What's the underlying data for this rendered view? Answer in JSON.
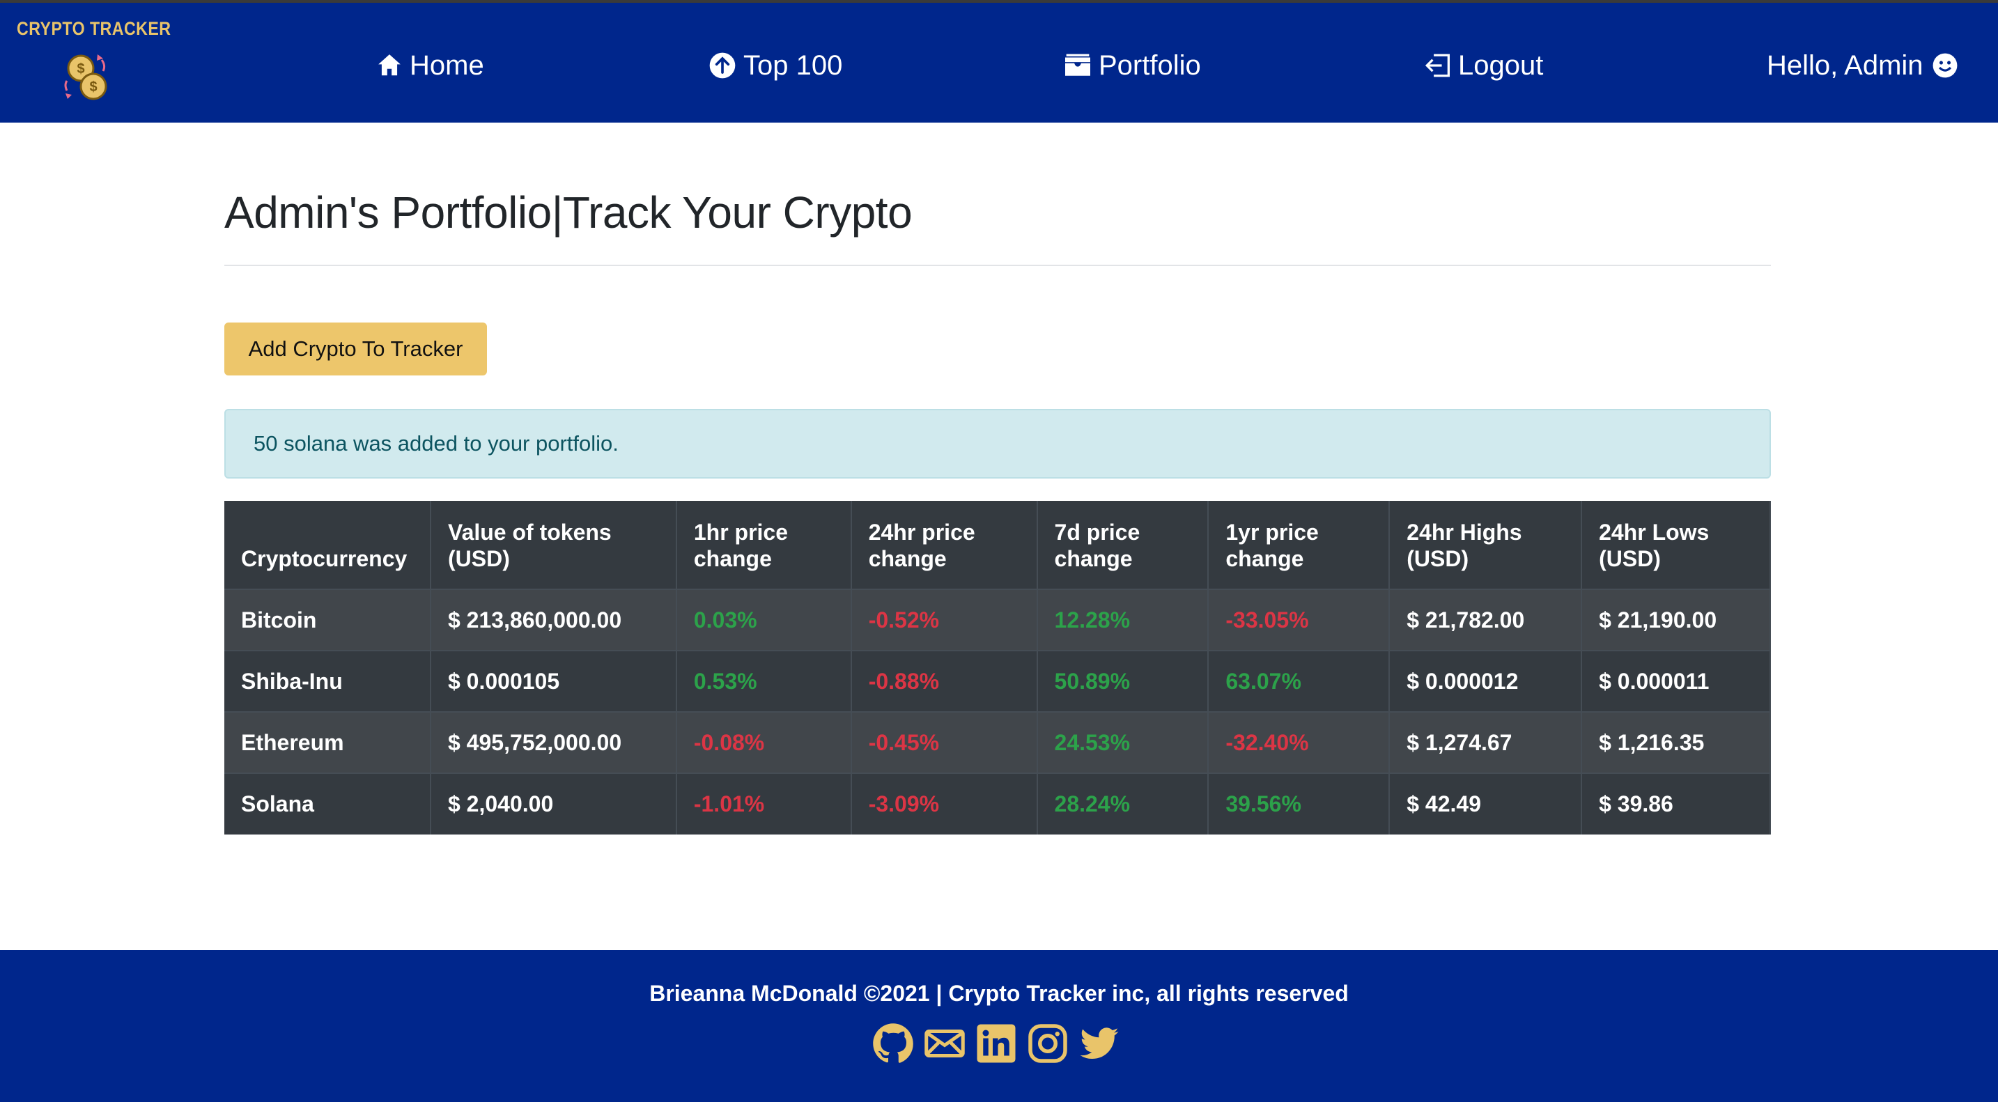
{
  "brand": {
    "name": "CRYPTO TRACKER",
    "accent": "#e9c46a",
    "logo_icon": "coins-icon"
  },
  "nav": {
    "home": "Home",
    "top100": "Top 100",
    "portfolio": "Portfolio",
    "logout": "Logout",
    "greeting": "Hello, Admin",
    "bg_color": "#00268c"
  },
  "page": {
    "title": "Admin's Portfolio|Track Your Crypto",
    "add_button": "Add Crypto To Tracker",
    "alert": "50 solana was added to your portfolio."
  },
  "table": {
    "headers": [
      "Cryptocurrency",
      "Value of tokens (USD)",
      "1hr price change",
      "24hr price change",
      "7d price change",
      "1yr price change",
      "24hr Highs (USD)",
      "24hr Lows (USD)"
    ],
    "rows": [
      {
        "name": "Bitcoin",
        "value": "$ 213,860,000.00",
        "h1": "0.03%",
        "h24": "-0.52%",
        "d7": "12.28%",
        "y1": "-33.05%",
        "high": "$ 21,782.00",
        "low": "$ 21,190.00"
      },
      {
        "name": "Shiba-Inu",
        "value": "$ 0.000105",
        "h1": "0.53%",
        "h24": "-0.88%",
        "d7": "50.89%",
        "y1": "63.07%",
        "high": "$ 0.000012",
        "low": "$ 0.000011"
      },
      {
        "name": "Ethereum",
        "value": "$ 495,752,000.00",
        "h1": "-0.08%",
        "h24": "-0.45%",
        "d7": "24.53%",
        "y1": "-32.40%",
        "high": "$ 1,274.67",
        "low": "$ 1,216.35"
      },
      {
        "name": "Solana",
        "value": "$ 2,040.00",
        "h1": "-1.01%",
        "h24": "-3.09%",
        "d7": "28.24%",
        "y1": "39.56%",
        "high": "$ 42.49",
        "low": "$ 39.86"
      }
    ],
    "positive_color": "#2ca24a",
    "negative_color": "#dc3545"
  },
  "footer": {
    "text": "Brieanna McDonald ©2021 | Crypto Tracker inc, all rights reserved",
    "social_icons": [
      "github-icon",
      "email-icon",
      "linkedin-icon",
      "instagram-icon",
      "twitter-icon"
    ]
  }
}
